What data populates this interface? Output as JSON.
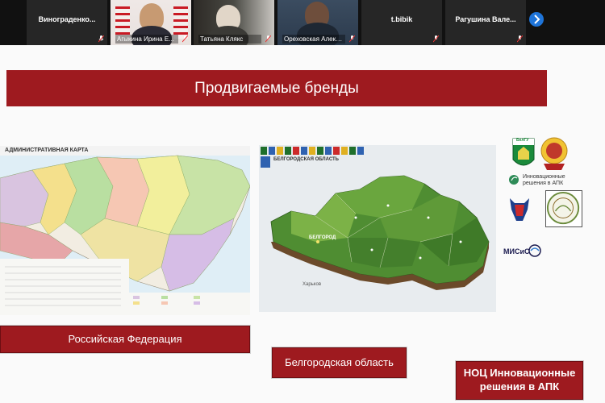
{
  "participants": [
    {
      "name": "Винограденко...",
      "has_video": false
    },
    {
      "name": "Агыкина Ирина Е...",
      "has_video": true
    },
    {
      "name": "Татьяна Клякс",
      "has_video": true
    },
    {
      "name": "Ореховская Алекс...",
      "has_video": true
    },
    {
      "name": "t.bibik",
      "has_video": false
    },
    {
      "name": "Рагушина Вале...",
      "has_video": false
    }
  ],
  "slide": {
    "title": "Продвигаемые бренды",
    "labels": {
      "russia": "Российская Федерация",
      "belgorod": "Белгородская область",
      "noc": "НОЦ Инновационные решения в АПК"
    },
    "map_titles": {
      "russia": "АДМИНИСТРАТИВНАЯ КАРТА",
      "belgorod": "БЕЛГОРОДСКАЯ ОБЛАСТЬ"
    },
    "map_places": {
      "belgorod": "БЕЛГОРОД",
      "kharkov": "Харьков"
    },
    "logos": {
      "belgu": "БелГУ",
      "innov": "Инновационные решения в АПК",
      "misis": "МИСиС"
    }
  },
  "colors": {
    "accent": "#9e1a1f",
    "nav_button": "#1e74d9"
  }
}
